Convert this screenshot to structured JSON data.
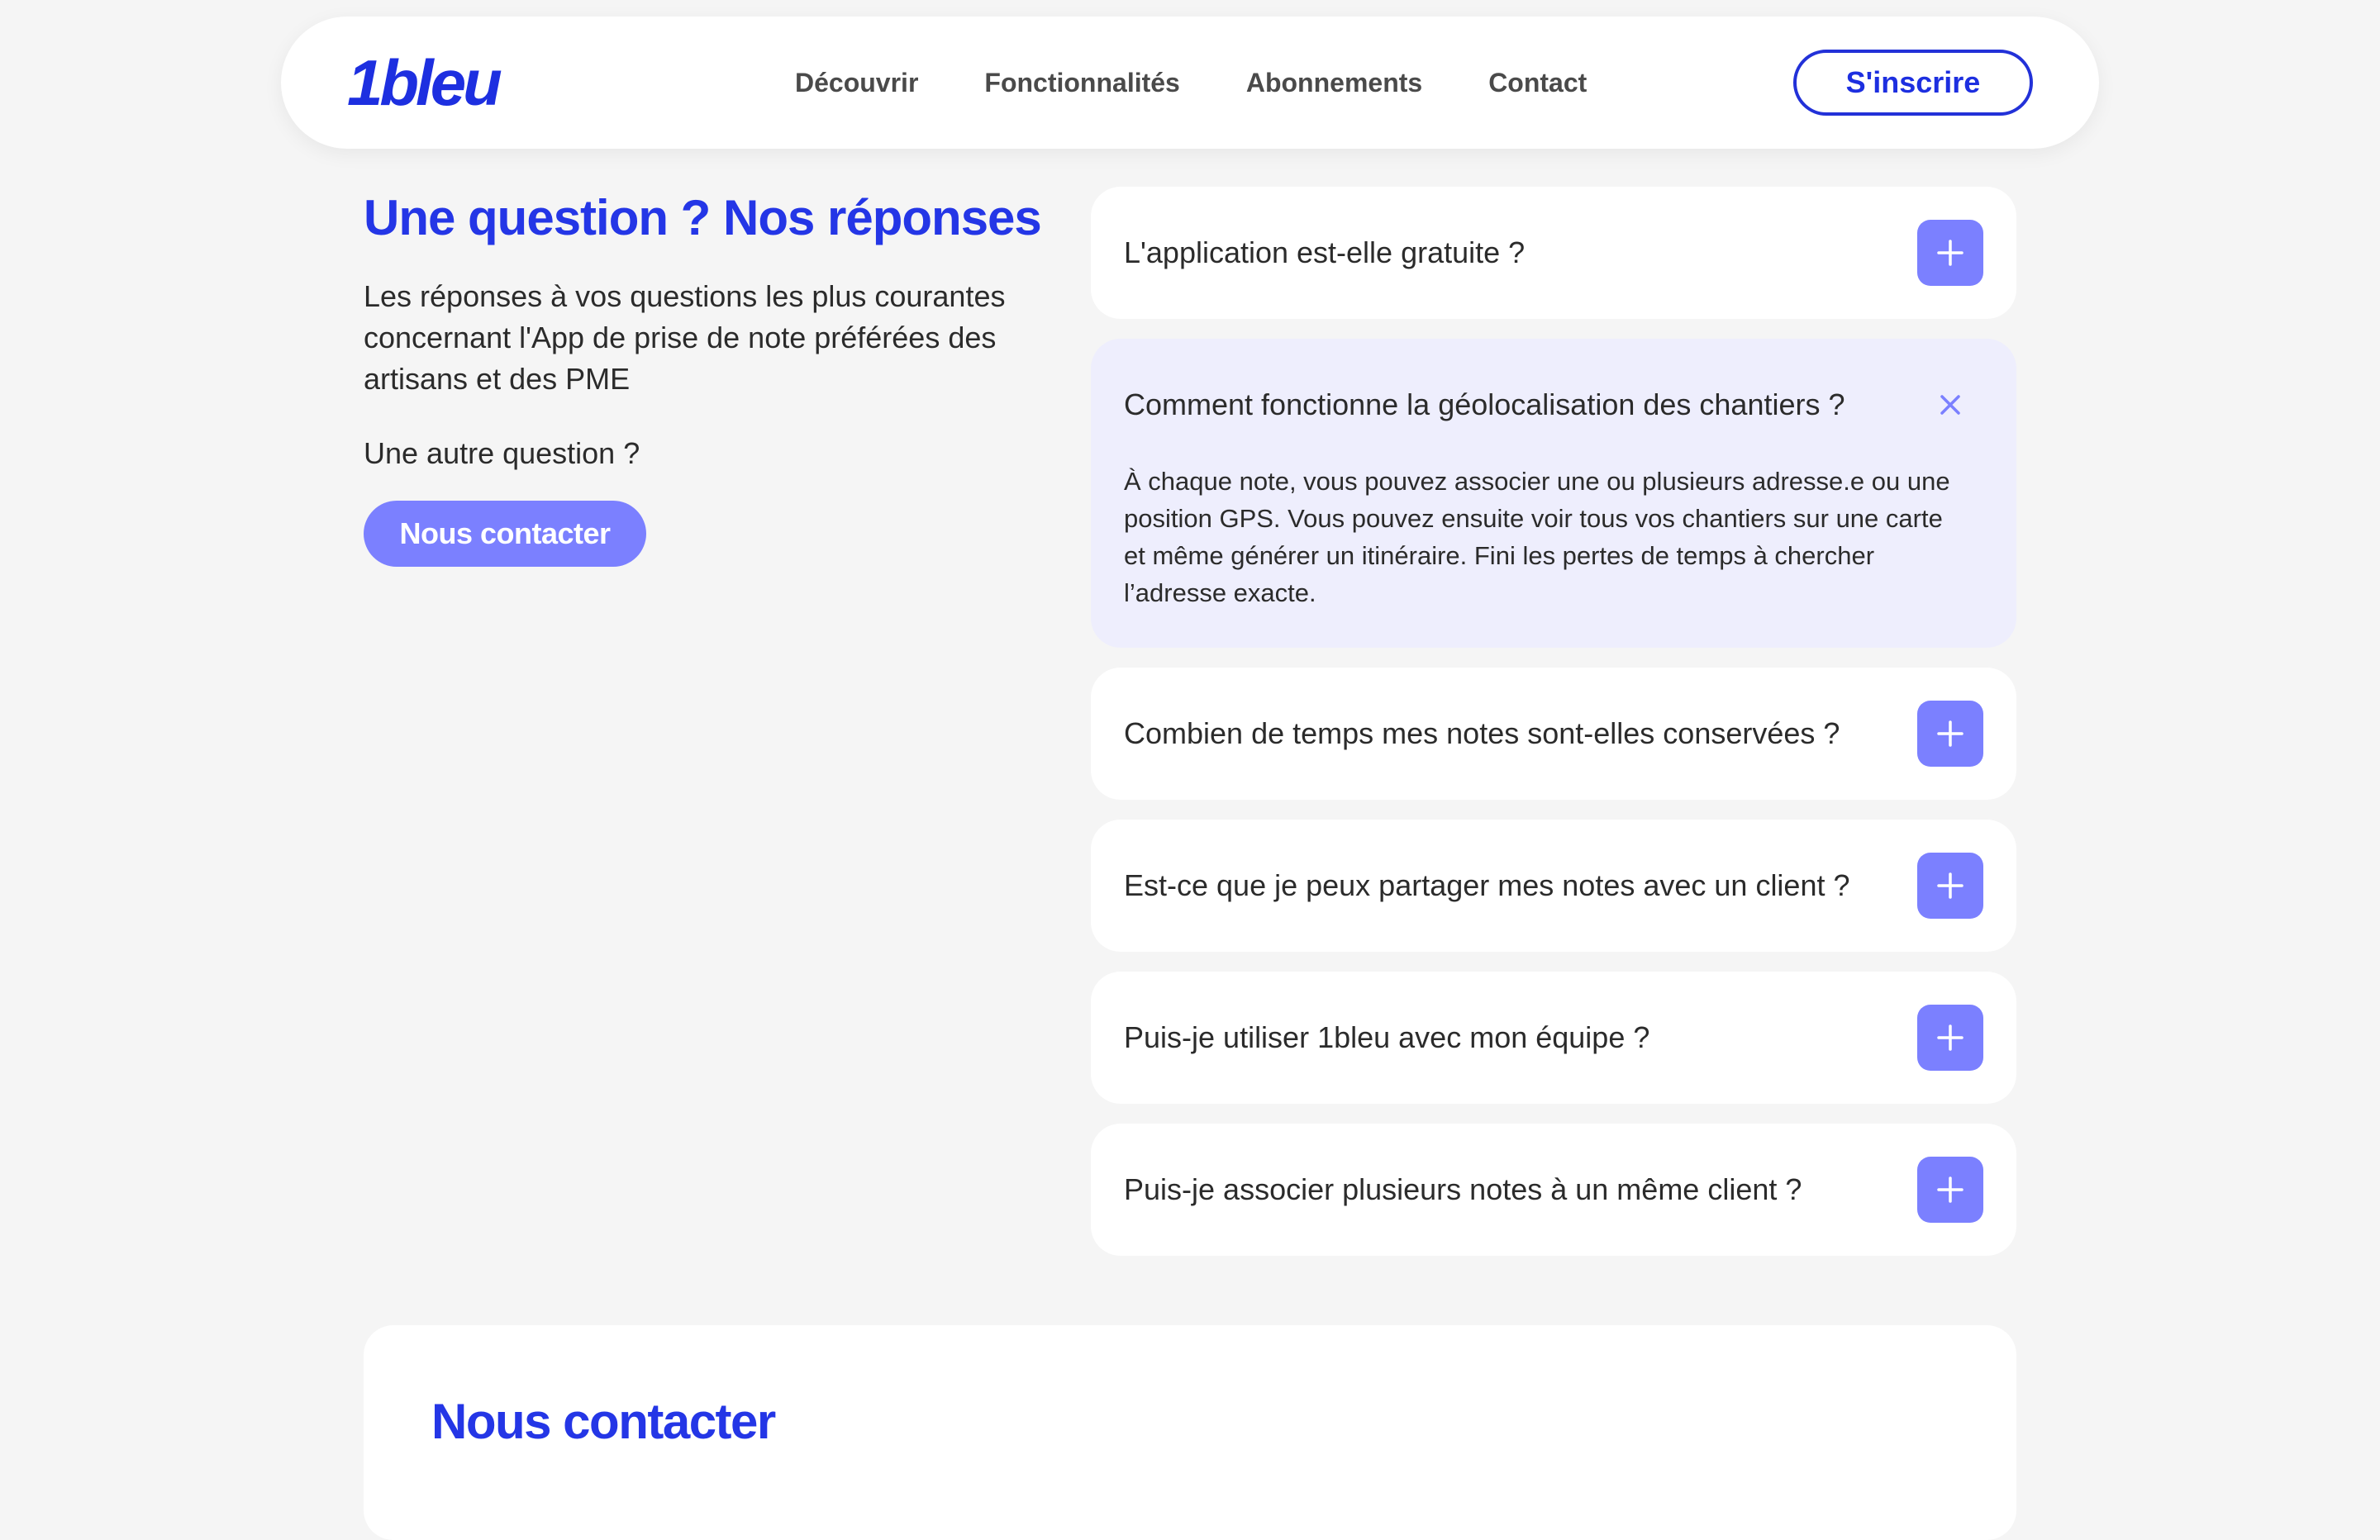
{
  "header": {
    "logo": "1bleu",
    "nav": [
      "Découvrir",
      "Fonctionnalités",
      "Abonnements",
      "Contact"
    ],
    "signup_label": "S'inscrire"
  },
  "faq": {
    "title": "Une question ? Nos réponses",
    "description": "Les réponses à vos questions les plus courantes concernant l'App de prise de note préférées des artisans et des PME",
    "other_question": "Une autre question ?",
    "contact_button": "Nous contacter",
    "items": [
      {
        "question": "L'application est-elle gratuite ?",
        "open": false
      },
      {
        "question": "Comment fonctionne la géolocalisation des chantiers ?",
        "open": true,
        "answer": "À chaque note, vous pouvez associer une ou plusieurs adresse.e ou une position GPS. Vous pouvez ensuite voir tous vos chantiers sur une carte et même générer un itinéraire. Fini les pertes de temps à chercher l’adresse exacte."
      },
      {
        "question": "Combien de temps mes notes sont-elles conservées ?",
        "open": false
      },
      {
        "question": "Est-ce que je peux partager mes notes avec un client ?",
        "open": false
      },
      {
        "question": "Puis-je utiliser 1bleu avec mon équipe ?",
        "open": false
      },
      {
        "question": "Puis-je associer plusieurs notes à un même client ?",
        "open": false
      }
    ]
  },
  "contact_section": {
    "title": "Nous contacter"
  },
  "colors": {
    "brand": "#1d2fe0",
    "accent": "#7b80ff",
    "open_item_bg": "#eeeefd"
  },
  "icons": {
    "expand": "plus-icon",
    "collapse": "close-icon"
  }
}
